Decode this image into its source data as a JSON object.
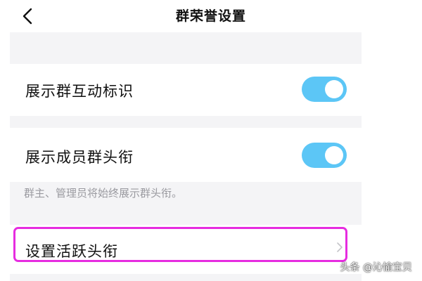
{
  "header": {
    "title": "群荣誉设置",
    "back_icon": "chevron-left-icon"
  },
  "settings": {
    "show_interaction_badge": {
      "label": "展示群互动标识",
      "enabled": true
    },
    "show_member_title": {
      "label": "展示成员群头衔",
      "enabled": true
    },
    "member_title_hint": "群主、管理员将始终展示群头衔。",
    "set_active_title": {
      "label": "设置活跃头衔",
      "icon": "chevron-right-icon"
    }
  },
  "colors": {
    "toggle_on": "#5cc6f6",
    "highlight": "#e62ce0",
    "group_background": "#f4f4f6"
  },
  "watermark": "头条 @沁愉宝贝"
}
